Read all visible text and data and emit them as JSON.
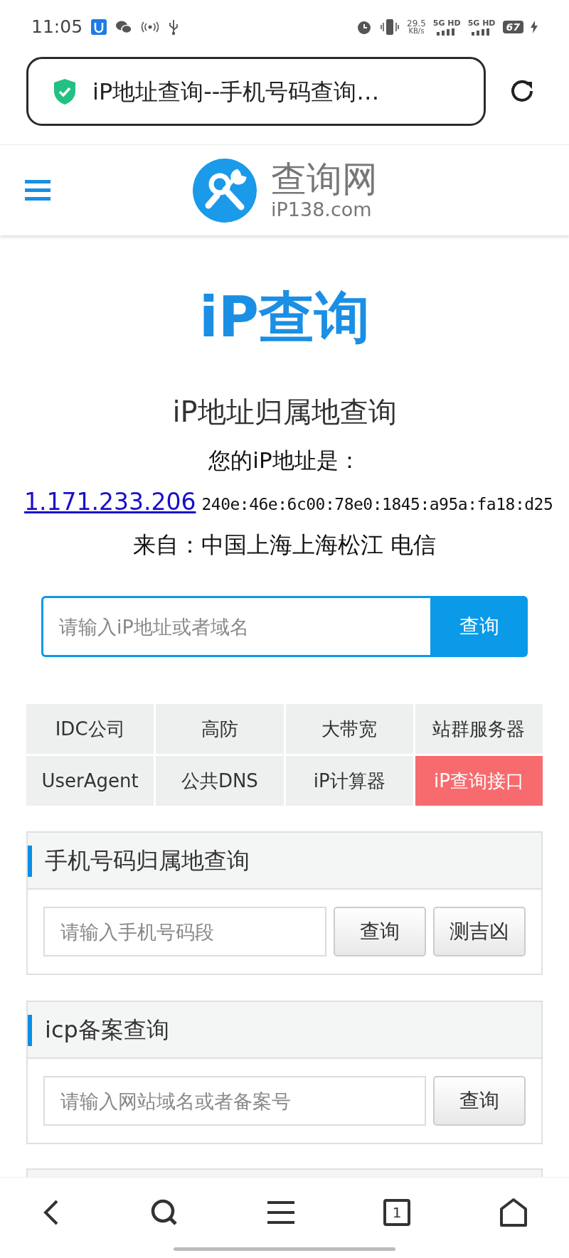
{
  "status_bar": {
    "time": "11:05",
    "net_speed": {
      "value": "29.5",
      "unit": "KB/s"
    },
    "networks": [
      "5G HD",
      "5G HD"
    ],
    "battery": "67"
  },
  "address_bar": {
    "title": "iP地址查询--手机号码查询…"
  },
  "header": {
    "logo_name": "查询网",
    "logo_domain": "iP138.com"
  },
  "hero_logo": "iP查询",
  "lookup": {
    "title": "iP地址归属地查询",
    "label": "您的iP地址是：",
    "ipv4": "1.171.233.206",
    "ipv6": "240e:46e:6c00:78e0:1845:a95a:fa18:d25",
    "location": "来自：中国上海上海松江 电信"
  },
  "search": {
    "placeholder": "请输入iP地址或者域名",
    "button": "查询"
  },
  "links": [
    {
      "label": "IDC公司",
      "highlighted": false
    },
    {
      "label": "高防",
      "highlighted": false
    },
    {
      "label": "大带宽",
      "highlighted": false
    },
    {
      "label": "站群服务器",
      "highlighted": false
    },
    {
      "label": "UserAgent",
      "highlighted": false
    },
    {
      "label": "公共DNS",
      "highlighted": false
    },
    {
      "label": "iP计算器",
      "highlighted": false
    },
    {
      "label": "iP查询接口",
      "highlighted": true
    }
  ],
  "sections": [
    {
      "title": "手机号码归属地查询",
      "placeholder": "请输入手机号码段",
      "buttons": [
        "查询",
        "测吉凶"
      ]
    },
    {
      "title": "icp备案查询",
      "placeholder": "请输入网站域名或者备案号",
      "buttons": [
        "查询"
      ]
    }
  ],
  "bottom_nav": {
    "tab_count": "1"
  }
}
